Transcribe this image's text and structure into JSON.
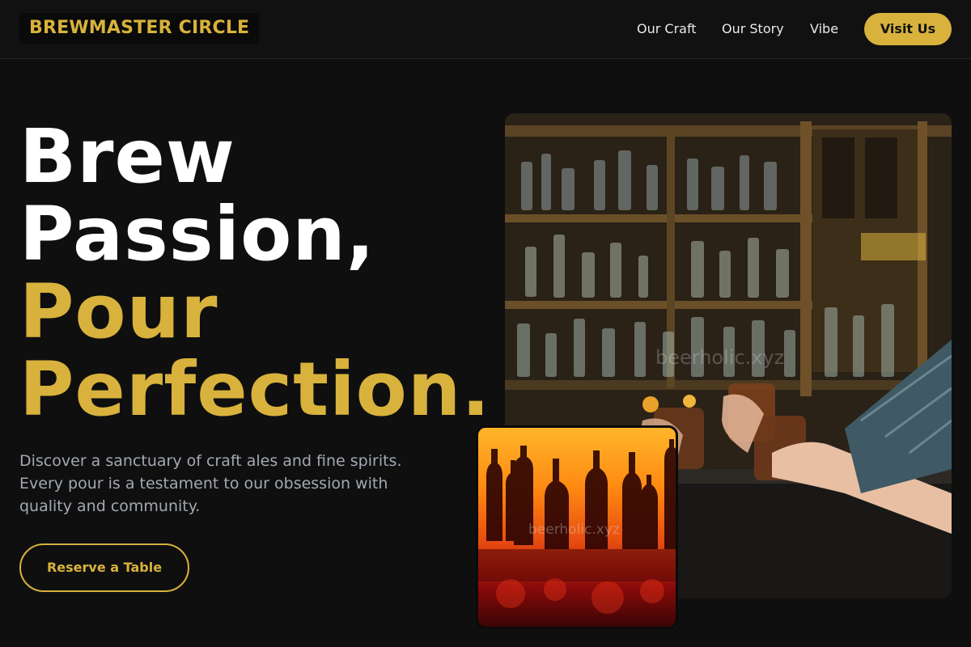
{
  "header": {
    "logo": "BREWMASTER CIRCLE",
    "nav": [
      "Our Craft",
      "Our Story",
      "Vibe"
    ],
    "cta": "Visit Us"
  },
  "hero": {
    "headline_line1": "Brew",
    "headline_line2": "Passion,",
    "headline_line3": "Pour",
    "headline_line4": "Perfection.",
    "description": "Discover a sanctuary of craft ales and fine spirits. Every pour is a testament to our obsession with quality and community.",
    "button": "Reserve a Table"
  },
  "images": {
    "main_watermark": "beerholic.xyz",
    "small_watermark": "beerholic.xyz"
  },
  "colors": {
    "accent": "#d8b23c",
    "background": "#0f0f0f",
    "header": "#111111",
    "body_text": "#a3a8b2"
  }
}
